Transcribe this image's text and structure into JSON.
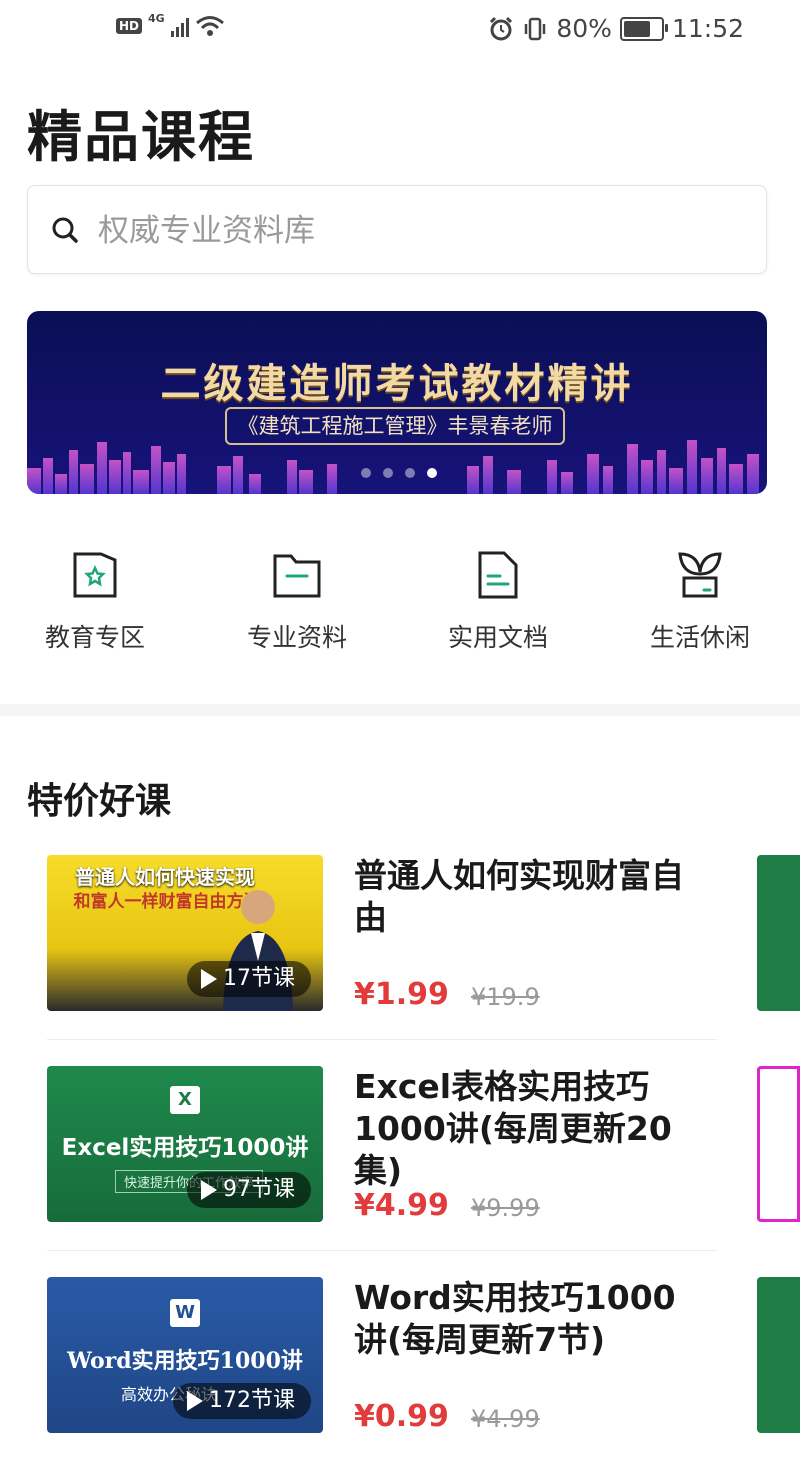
{
  "status_bar": {
    "hd": "HD",
    "signal": "4G",
    "battery_pct": "80%",
    "battery_level": 0.8,
    "time": "11:52"
  },
  "page": {
    "title": "精品课程"
  },
  "search": {
    "placeholder": "权威专业资料库"
  },
  "banner": {
    "title": "二级建造师考试教材精讲",
    "subtitle": "《建筑工程施工管理》丰景春老师",
    "slide_count": 4,
    "active_slide": 4
  },
  "categories": [
    {
      "label": "教育专区",
      "icon": "star-folder-icon"
    },
    {
      "label": "专业资料",
      "icon": "folder-icon"
    },
    {
      "label": "实用文档",
      "icon": "document-icon"
    },
    {
      "label": "生活休闲",
      "icon": "plant-icon"
    }
  ],
  "section": {
    "title": "特价好课"
  },
  "courses": [
    {
      "title": "普通人如何实现财富自由",
      "price": "¥1.99",
      "original_price": "¥19.9",
      "lessons": "17节课",
      "thumb": {
        "line1": "普通人如何快速实现",
        "line2": "和富人一样财富自由方法",
        "bg": "#f2d21c"
      }
    },
    {
      "title": "Excel表格实用技巧1000讲(每周更新20集)",
      "price": "¥4.99",
      "original_price": "¥9.99",
      "lessons": "97节课",
      "thumb": {
        "badge": "X",
        "line1": "Excel实用技巧1000讲",
        "line2": "快速提升你的工作效率",
        "bg": "#1e7d45"
      }
    },
    {
      "title": "Word实用技巧1000讲(每周更新7节)",
      "price": "¥0.99",
      "original_price": "¥4.99",
      "lessons": "172节课",
      "thumb": {
        "badge": "W",
        "line1": "Word实用技巧1000讲",
        "line2": "高效办公秘诀",
        "bg": "#234f94"
      }
    }
  ],
  "colors": {
    "price_red": "#e23b3b",
    "accent_green": "#1fa67a",
    "banner_bg": "#0f1260"
  }
}
